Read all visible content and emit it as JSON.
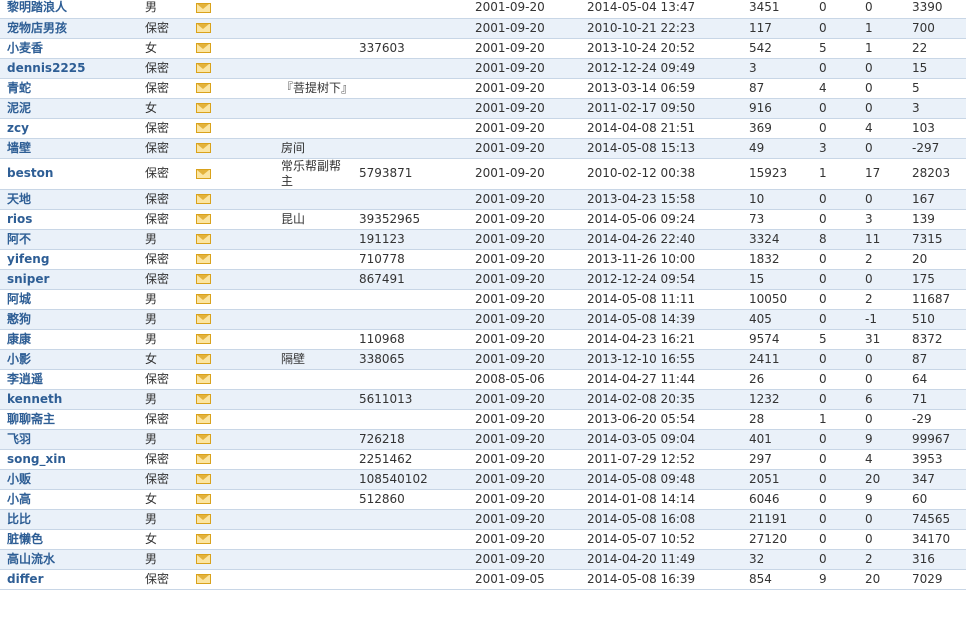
{
  "colors": {
    "accent": "#2e5e95",
    "row_alt": "#eaf1f9",
    "border": "#c8d6e6"
  },
  "icons": {
    "mail": "envelope-icon"
  },
  "rows": [
    {
      "name": "黎明踏浪人",
      "gender": "男",
      "site": "",
      "qq": "",
      "reg": "2001-09-20",
      "last": "2014-05-04 13:47",
      "posts": "3451",
      "digest": "0",
      "rating": "0",
      "credits": "3390"
    },
    {
      "name": "宠物店男孩",
      "gender": "保密",
      "site": "",
      "qq": "",
      "reg": "2001-09-20",
      "last": "2010-10-21 22:23",
      "posts": "117",
      "digest": "0",
      "rating": "1",
      "credits": "700"
    },
    {
      "name": "小麦香",
      "gender": "女",
      "site": "",
      "qq": "337603",
      "reg": "2001-09-20",
      "last": "2013-10-24 20:52",
      "posts": "542",
      "digest": "5",
      "rating": "1",
      "credits": "22"
    },
    {
      "name": "dennis2225",
      "gender": "保密",
      "site": "",
      "qq": "",
      "reg": "2001-09-20",
      "last": "2012-12-24 09:49",
      "posts": "3",
      "digest": "0",
      "rating": "0",
      "credits": "15"
    },
    {
      "name": "青蛇",
      "gender": "保密",
      "site": "『菩提树下』",
      "qq": "",
      "reg": "2001-09-20",
      "last": "2013-03-14 06:59",
      "posts": "87",
      "digest": "4",
      "rating": "0",
      "credits": "5",
      "tall": true
    },
    {
      "name": "泥泥",
      "gender": "女",
      "site": "",
      "qq": "",
      "reg": "2001-09-20",
      "last": "2011-02-17 09:50",
      "posts": "916",
      "digest": "0",
      "rating": "0",
      "credits": "3"
    },
    {
      "name": "zcy",
      "gender": "保密",
      "site": "",
      "qq": "",
      "reg": "2001-09-20",
      "last": "2014-04-08 21:51",
      "posts": "369",
      "digest": "0",
      "rating": "4",
      "credits": "103"
    },
    {
      "name": "墙壁",
      "gender": "保密",
      "site": "房间",
      "qq": "",
      "reg": "2001-09-20",
      "last": "2014-05-08 15:13",
      "posts": "49",
      "digest": "3",
      "rating": "0",
      "credits": "-297"
    },
    {
      "name": "beston",
      "gender": "保密",
      "site": "常乐帮副帮主",
      "qq": "5793871",
      "reg": "2001-09-20",
      "last": "2010-02-12 00:38",
      "posts": "15923",
      "digest": "1",
      "rating": "17",
      "credits": "28203",
      "tall": true
    },
    {
      "name": "天地",
      "gender": "保密",
      "site": "",
      "qq": "",
      "reg": "2001-09-20",
      "last": "2013-04-23 15:58",
      "posts": "10",
      "digest": "0",
      "rating": "0",
      "credits": "167"
    },
    {
      "name": "rios",
      "gender": "保密",
      "site": "昆山",
      "qq": "39352965",
      "reg": "2001-09-20",
      "last": "2014-05-06 09:24",
      "posts": "73",
      "digest": "0",
      "rating": "3",
      "credits": "139"
    },
    {
      "name": "阿不",
      "gender": "男",
      "site": "",
      "qq": "191123",
      "reg": "2001-09-20",
      "last": "2014-04-26 22:40",
      "posts": "3324",
      "digest": "8",
      "rating": "11",
      "credits": "7315"
    },
    {
      "name": "yifeng",
      "gender": "保密",
      "site": "",
      "qq": "710778",
      "reg": "2001-09-20",
      "last": "2013-11-26 10:00",
      "posts": "1832",
      "digest": "0",
      "rating": "2",
      "credits": "20"
    },
    {
      "name": "sniper",
      "gender": "保密",
      "site": "",
      "qq": "867491",
      "reg": "2001-09-20",
      "last": "2012-12-24 09:54",
      "posts": "15",
      "digest": "0",
      "rating": "0",
      "credits": "175"
    },
    {
      "name": "阿城",
      "gender": "男",
      "site": "",
      "qq": "",
      "reg": "2001-09-20",
      "last": "2014-05-08 11:11",
      "posts": "10050",
      "digest": "0",
      "rating": "2",
      "credits": "11687"
    },
    {
      "name": "憨狗",
      "gender": "男",
      "site": "",
      "qq": "",
      "reg": "2001-09-20",
      "last": "2014-05-08 14:39",
      "posts": "405",
      "digest": "0",
      "rating": "-1",
      "credits": "510"
    },
    {
      "name": "康康",
      "gender": "男",
      "site": "",
      "qq": "110968",
      "reg": "2001-09-20",
      "last": "2014-04-23 16:21",
      "posts": "9574",
      "digest": "5",
      "rating": "31",
      "credits": "8372"
    },
    {
      "name": "小影",
      "gender": "女",
      "site": "隔壁",
      "qq": "338065",
      "reg": "2001-09-20",
      "last": "2013-12-10 16:55",
      "posts": "2411",
      "digest": "0",
      "rating": "0",
      "credits": "87"
    },
    {
      "name": "李逍遥",
      "gender": "保密",
      "site": "",
      "qq": "",
      "reg": "2008-05-06",
      "last": "2014-04-27 11:44",
      "posts": "26",
      "digest": "0",
      "rating": "0",
      "credits": "64"
    },
    {
      "name": "kenneth",
      "gender": "男",
      "site": "",
      "qq": "5611013",
      "reg": "2001-09-20",
      "last": "2014-02-08 20:35",
      "posts": "1232",
      "digest": "0",
      "rating": "6",
      "credits": "71"
    },
    {
      "name": "聊聊斋主",
      "gender": "保密",
      "site": "",
      "qq": "",
      "reg": "2001-09-20",
      "last": "2013-06-20 05:54",
      "posts": "28",
      "digest": "1",
      "rating": "0",
      "credits": "-29"
    },
    {
      "name": "飞羽",
      "gender": "男",
      "site": "",
      "qq": "726218",
      "reg": "2001-09-20",
      "last": "2014-03-05 09:04",
      "posts": "401",
      "digest": "0",
      "rating": "9",
      "credits": "99967"
    },
    {
      "name": "song_xin",
      "gender": "保密",
      "site": "",
      "qq": "2251462",
      "reg": "2001-09-20",
      "last": "2011-07-29 12:52",
      "posts": "297",
      "digest": "0",
      "rating": "4",
      "credits": "3953"
    },
    {
      "name": "小贩",
      "gender": "保密",
      "site": "",
      "qq": "108540102",
      "reg": "2001-09-20",
      "last": "2014-05-08 09:48",
      "posts": "2051",
      "digest": "0",
      "rating": "20",
      "credits": "347"
    },
    {
      "name": "小高",
      "gender": "女",
      "site": "",
      "qq": "512860",
      "reg": "2001-09-20",
      "last": "2014-01-08 14:14",
      "posts": "6046",
      "digest": "0",
      "rating": "9",
      "credits": "60"
    },
    {
      "name": "比比",
      "gender": "男",
      "site": "",
      "qq": "",
      "reg": "2001-09-20",
      "last": "2014-05-08 16:08",
      "posts": "21191",
      "digest": "0",
      "rating": "0",
      "credits": "74565"
    },
    {
      "name": "脏懒色",
      "gender": "女",
      "site": "",
      "qq": "",
      "reg": "2001-09-20",
      "last": "2014-05-07 10:52",
      "posts": "27120",
      "digest": "0",
      "rating": "0",
      "credits": "34170"
    },
    {
      "name": "高山流水",
      "gender": "男",
      "site": "",
      "qq": "",
      "reg": "2001-09-20",
      "last": "2014-04-20 11:49",
      "posts": "32",
      "digest": "0",
      "rating": "2",
      "credits": "316"
    },
    {
      "name": "differ",
      "gender": "保密",
      "site": "",
      "qq": "",
      "reg": "2001-09-05",
      "last": "2014-05-08 16:39",
      "posts": "854",
      "digest": "9",
      "rating": "20",
      "credits": "7029"
    }
  ]
}
